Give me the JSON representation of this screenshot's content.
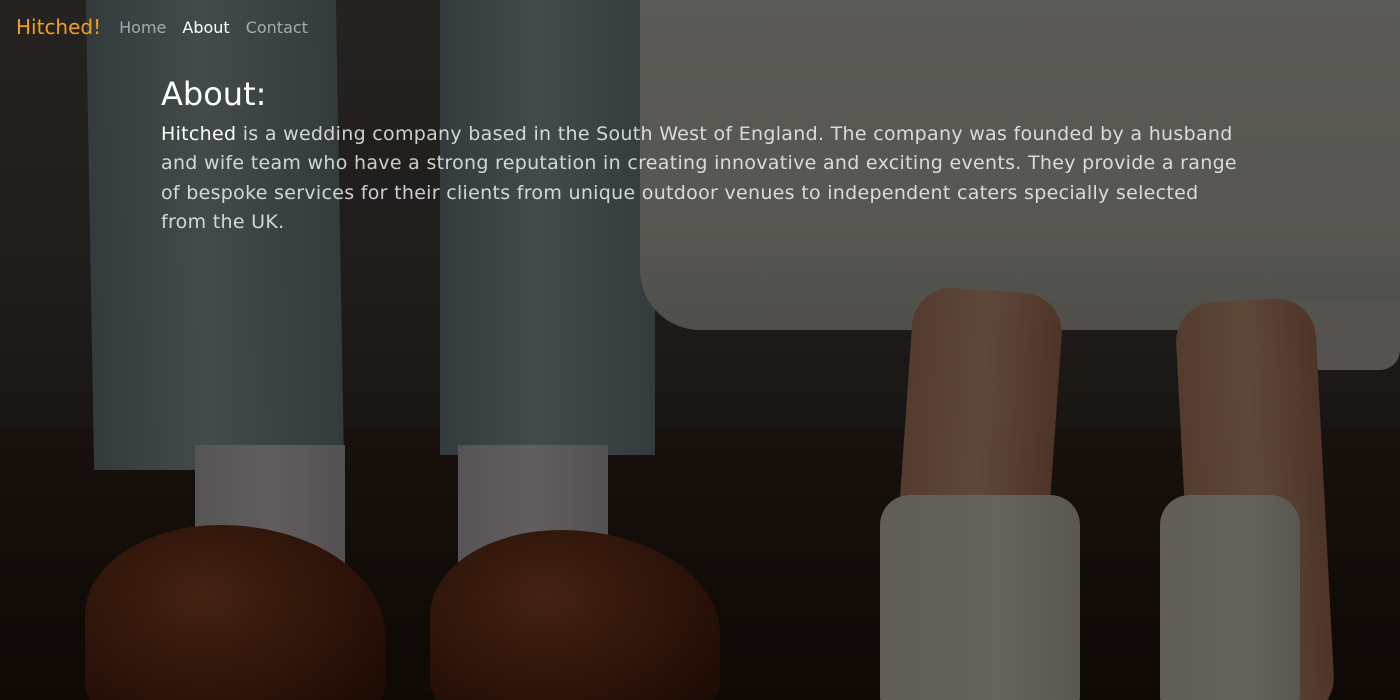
{
  "navbar": {
    "brand": "Hitched!",
    "links": [
      {
        "label": "Home",
        "active": false
      },
      {
        "label": "About",
        "active": true
      },
      {
        "label": "Contact",
        "active": false
      }
    ]
  },
  "main": {
    "heading": "About:",
    "highlight": "Hitched",
    "body": " is a wedding company based in the South West of England. The company was founded by a husband and wife team who have a strong reputation in creating innovative and exciting events. They provide a range of bespoke services for their clients from unique outdoor venues to independent caters specially selected from the UK."
  },
  "colors": {
    "brand": "#f0a020",
    "nav_inactive": "rgba(255,255,255,0.55)",
    "nav_active": "#ffffff",
    "overlay": "rgba(0,0,0,0.58)"
  }
}
